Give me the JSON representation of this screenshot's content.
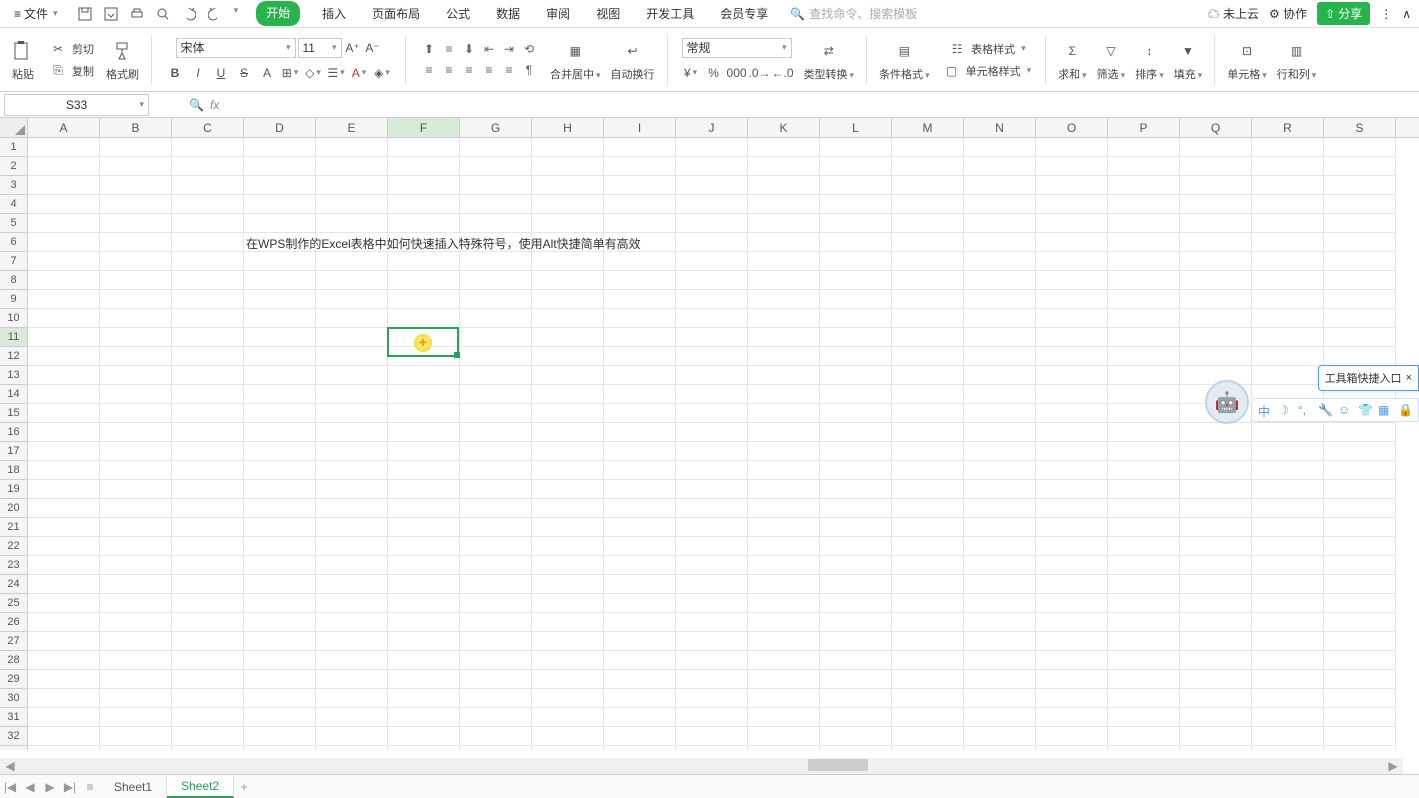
{
  "menu": {
    "file": "文件",
    "tabs": [
      "开始",
      "插入",
      "页面布局",
      "公式",
      "数据",
      "审阅",
      "视图",
      "开发工具",
      "会员专享"
    ],
    "search_ph": "查找命令、搜索模板",
    "cloud": "未上云",
    "collab": "协作",
    "share": "分享"
  },
  "ribbon": {
    "paste": "粘贴",
    "cut": "剪切",
    "copy": "复制",
    "format_painter": "格式刷",
    "font": "宋体",
    "size": "11",
    "merge": "合并居中",
    "wrap": "自动换行",
    "number_format": "常规",
    "type_convert": "类型转换",
    "cond_fmt": "条件格式",
    "table_style": "表格样式",
    "cell_style": "单元格样式",
    "sum": "求和",
    "filter": "筛选",
    "sort": "排序",
    "fill": "填充",
    "cells": "单元格",
    "rowcol": "行和列"
  },
  "namebox": "S33",
  "cols": [
    "A",
    "B",
    "C",
    "D",
    "E",
    "F",
    "G",
    "H",
    "I",
    "J",
    "K",
    "L",
    "M",
    "N",
    "O",
    "P",
    "Q",
    "R",
    "S"
  ],
  "rows_count": 33,
  "cell_text": "在WPS制作的Excel表格中如何快速插入特殊符号，使用Alt快捷简单有高效",
  "selected_cell": {
    "col": "F",
    "row": 11
  },
  "cell_text_pos": {
    "col": "D",
    "row": 6
  },
  "sheets": {
    "s1": "Sheet1",
    "s2": "Sheet2"
  },
  "floater": {
    "title": "工具箱快捷入口",
    "ime": "中"
  }
}
